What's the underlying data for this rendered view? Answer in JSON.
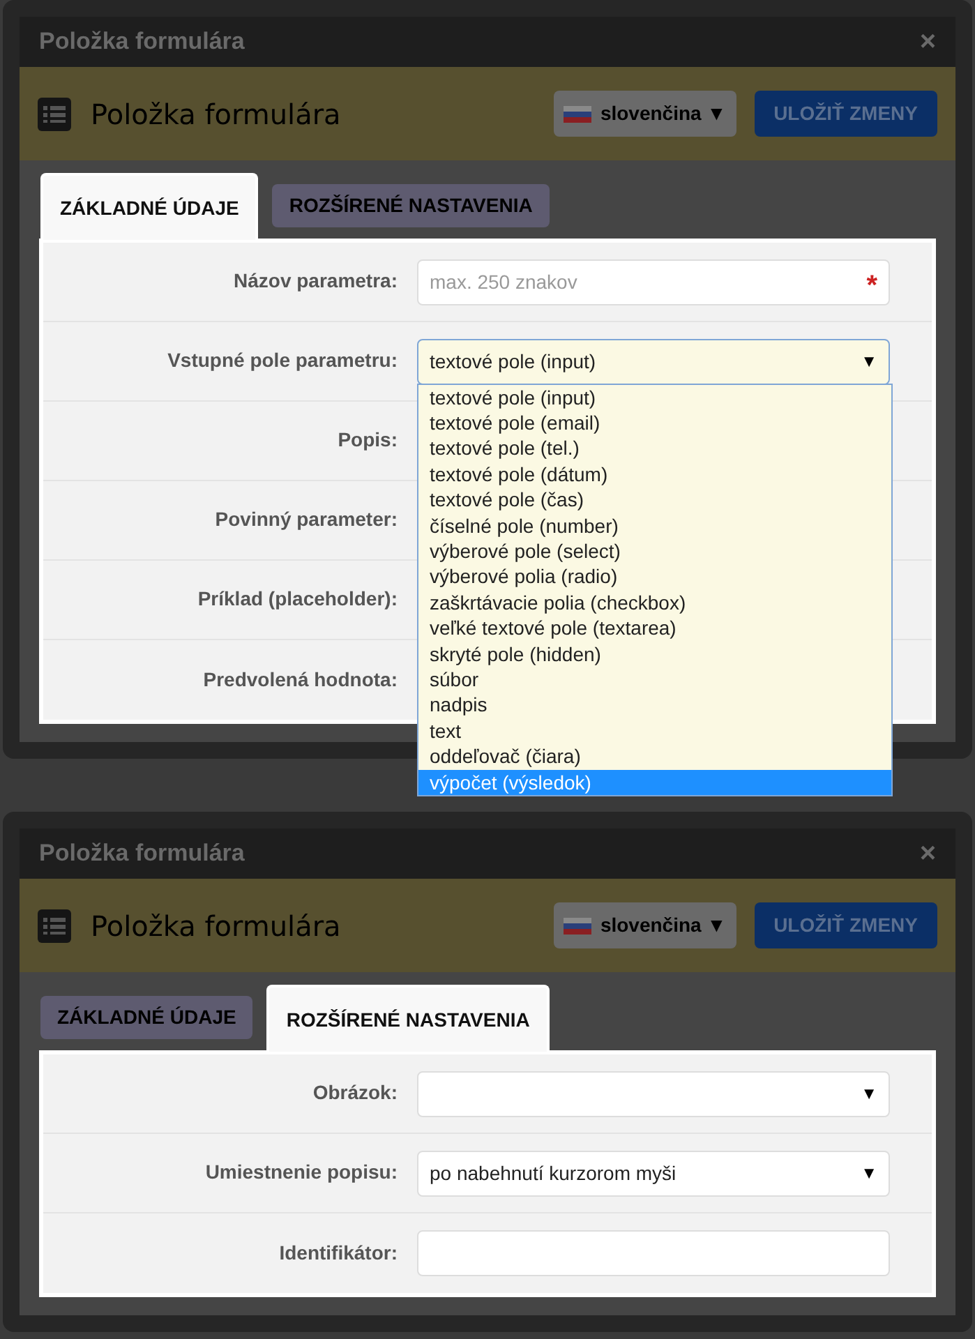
{
  "dialogs": [
    {
      "window": {
        "title": "Položka formulára",
        "close": "×"
      },
      "header": {
        "title": "Položka formulára",
        "language": "slovenčina",
        "language_caret": "▼",
        "save_button": "ULOŽIŤ ZMENY"
      },
      "tabs": [
        {
          "label": "ZÁKLADNÉ ÚDAJE",
          "selected": true
        },
        {
          "label": "ROZŠÍRENÉ NASTAVENIA",
          "selected": false
        }
      ],
      "rows": [
        {
          "label": "Názov parametra:",
          "field": {
            "kind": "input",
            "placeholder": "max. 250 znakov",
            "required_mark": "*"
          }
        },
        {
          "label": "Vstupné pole parametru:",
          "field": {
            "kind": "select",
            "value": "textové pole (input)",
            "caret": "▼",
            "focused": true,
            "options": [
              {
                "label": "textové pole (input)",
                "highlighted": false
              },
              {
                "label": "textové pole (email)",
                "highlighted": false
              },
              {
                "label": "textové pole (tel.)",
                "highlighted": false
              },
              {
                "label": "textové pole (dátum)",
                "highlighted": false
              },
              {
                "label": "textové pole (čas)",
                "highlighted": false
              },
              {
                "label": "číselné pole (number)",
                "highlighted": false
              },
              {
                "label": "výberové pole (select)",
                "highlighted": false
              },
              {
                "label": "výberové polia (radio)",
                "highlighted": false
              },
              {
                "label": "zaškrtávacie polia (checkbox)",
                "highlighted": false
              },
              {
                "label": "veľké textové pole (textarea)",
                "highlighted": false
              },
              {
                "label": "skryté pole (hidden)",
                "highlighted": false
              },
              {
                "label": "súbor",
                "highlighted": false
              },
              {
                "label": "nadpis",
                "highlighted": false
              },
              {
                "label": "text",
                "highlighted": false
              },
              {
                "label": "oddeľovač (čiara)",
                "highlighted": false
              },
              {
                "label": "výpočet (výsledok)",
                "highlighted": true
              }
            ]
          }
        },
        {
          "label": "Popis:"
        },
        {
          "label": "Povinný parameter:"
        },
        {
          "label": "Príklad (placeholder):"
        },
        {
          "label": "Predvolená hodnota:"
        }
      ]
    },
    {
      "window": {
        "title": "Položka formulára",
        "close": "×"
      },
      "header": {
        "title": "Položka formulára",
        "language": "slovenčina",
        "language_caret": "▼",
        "save_button": "ULOŽIŤ ZMENY"
      },
      "tabs": [
        {
          "label": "ZÁKLADNÉ ÚDAJE",
          "selected": false
        },
        {
          "label": "ROZŠÍRENÉ NASTAVENIA",
          "selected": true
        }
      ],
      "rows": [
        {
          "label": "Obrázok:",
          "field": {
            "kind": "select",
            "caret": "▼",
            "focused": false
          }
        },
        {
          "label": "Umiestnenie popisu:",
          "field": {
            "kind": "select",
            "value": "po nabehnutí kurzorom myši",
            "caret": "▼",
            "focused": false
          }
        },
        {
          "label": "Identifikátor:",
          "field": {
            "kind": "input"
          }
        }
      ]
    }
  ]
}
